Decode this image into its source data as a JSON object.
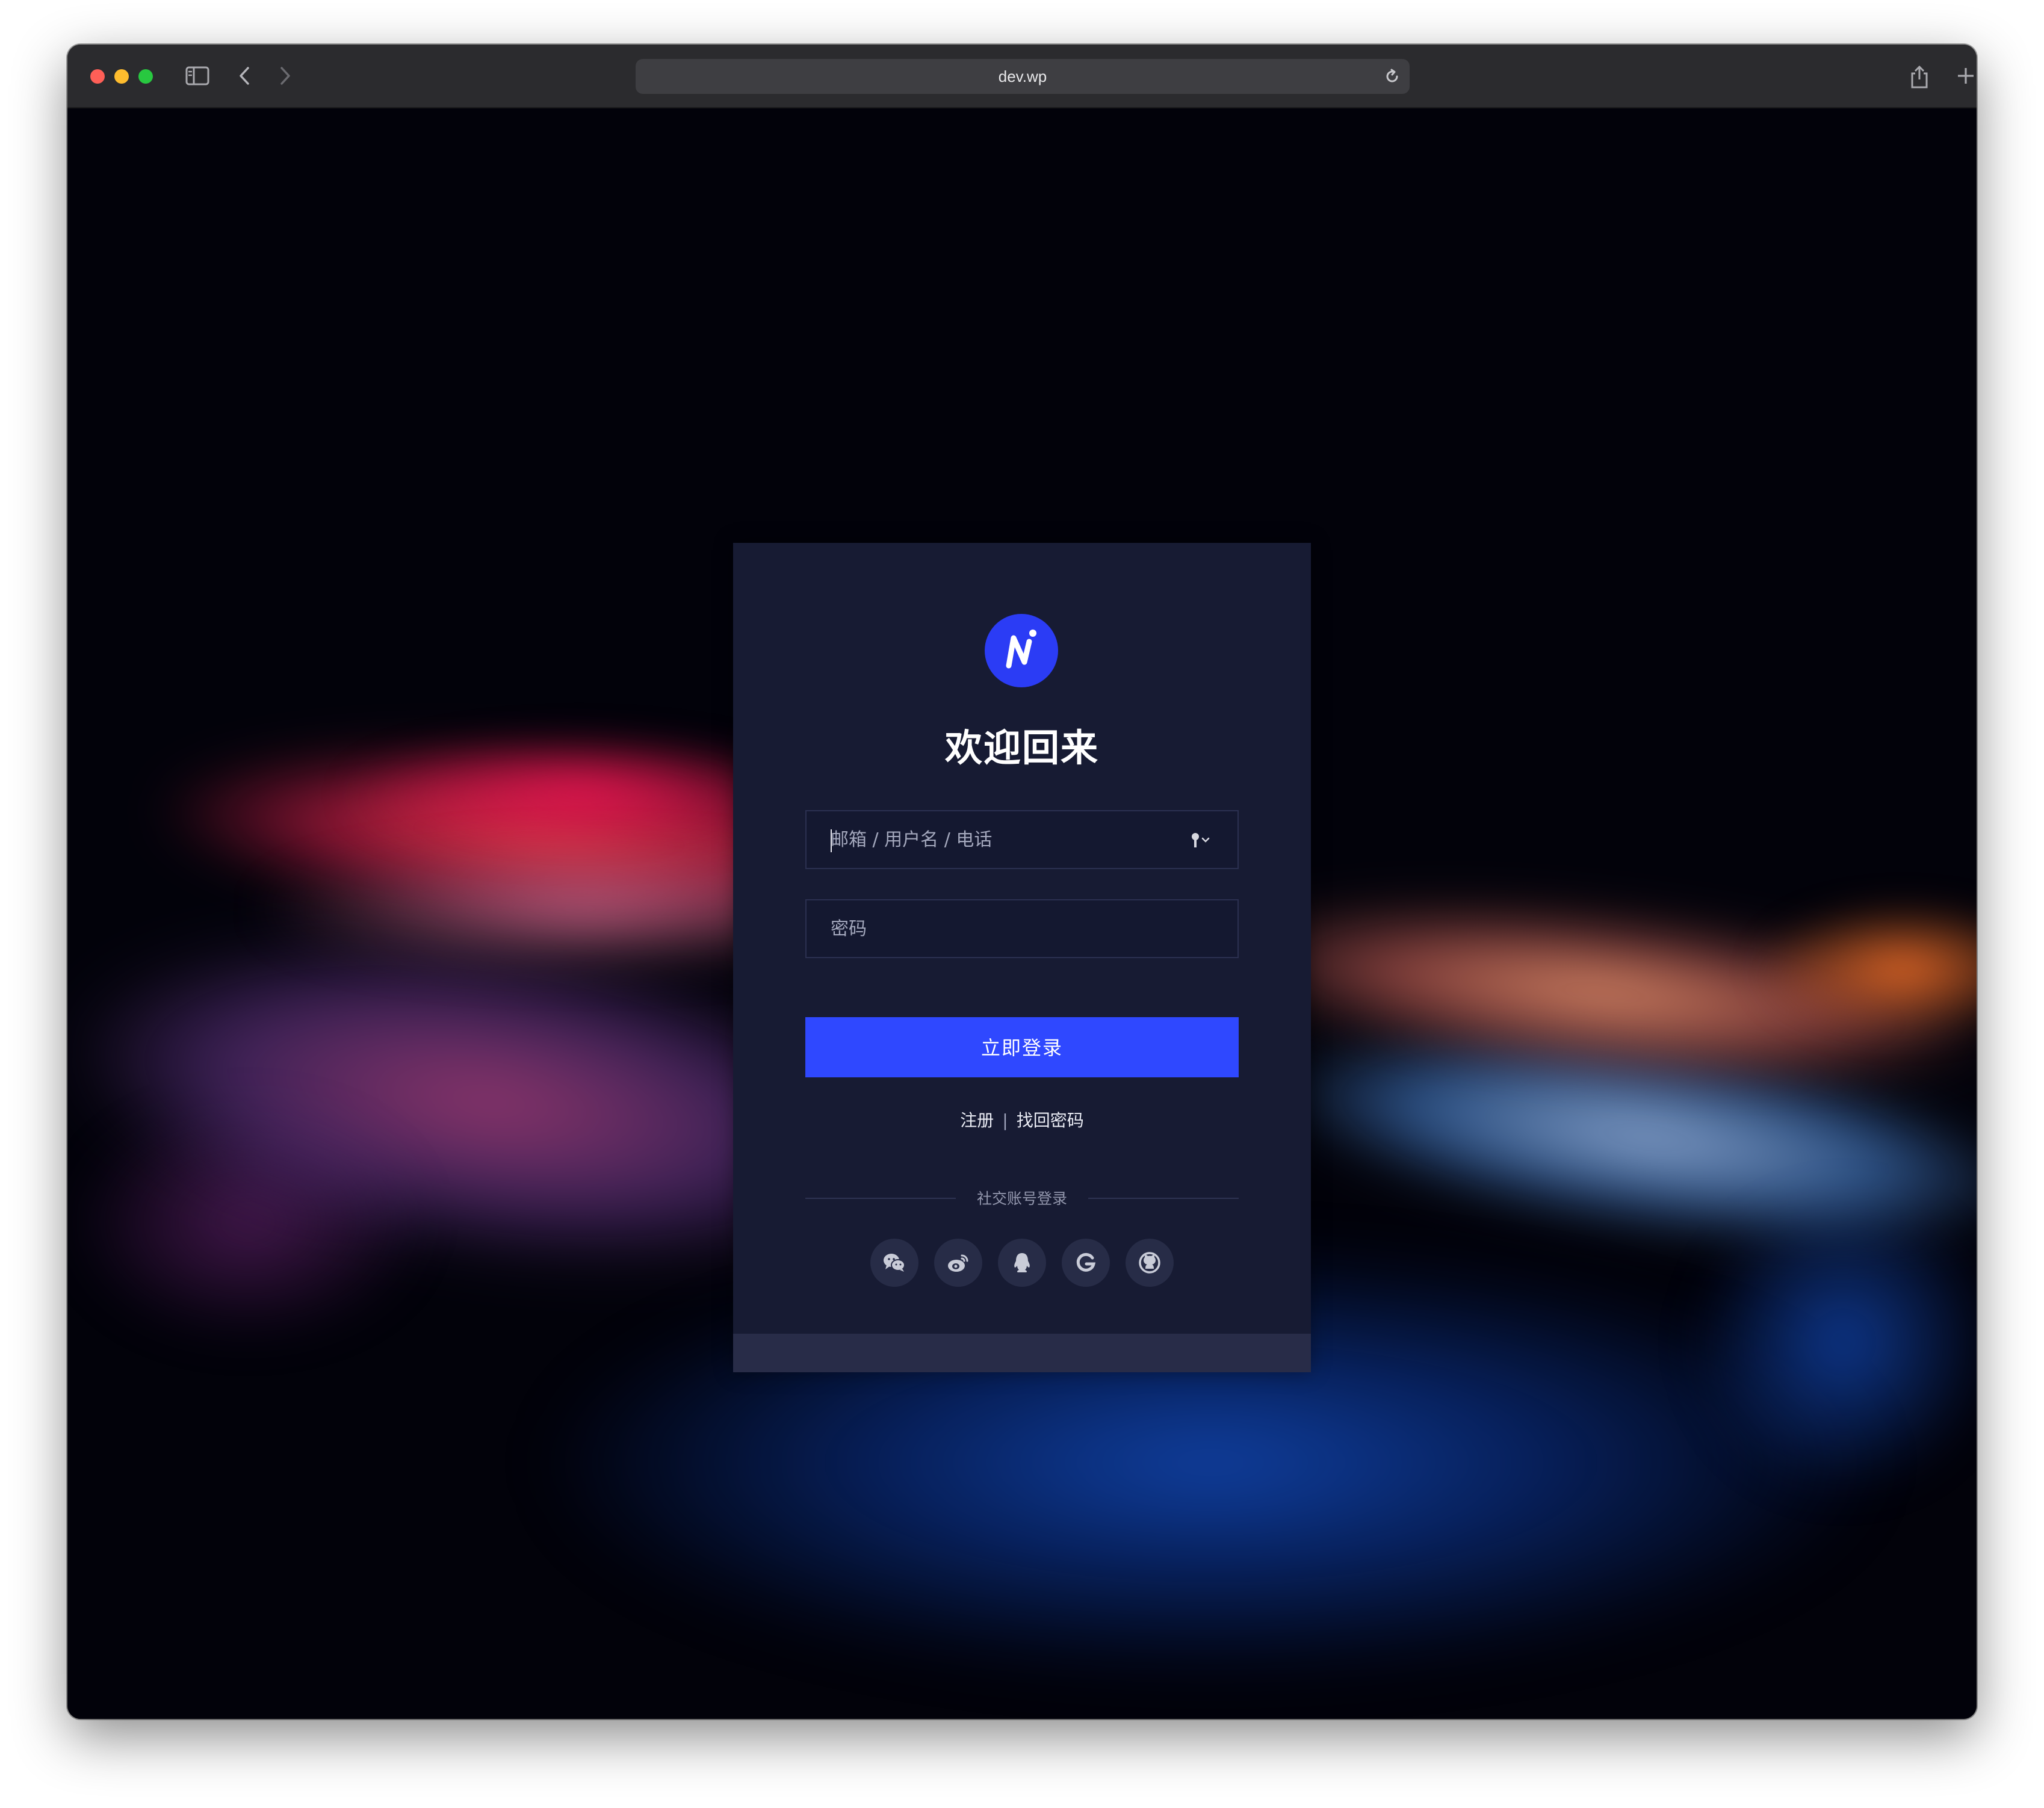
{
  "browser": {
    "url": "dev.wp"
  },
  "login": {
    "title": "欢迎回来",
    "username_placeholder": "邮箱 / 用户名 / 电话",
    "password_placeholder": "密码",
    "login_button": "立即登录",
    "register_link": "注册",
    "link_separator": "|",
    "forgot_link": "找回密码",
    "social_label": "社交账号登录",
    "social_providers": [
      "wechat-icon",
      "weibo-icon",
      "qq-icon",
      "google-icon",
      "github-icon"
    ]
  },
  "colors": {
    "accent": "#2f48ff",
    "logo": "#2b3cf5",
    "card": "#171b33"
  }
}
